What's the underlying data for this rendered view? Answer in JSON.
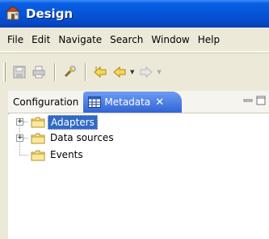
{
  "window": {
    "title": "Design",
    "icon": "design-app-icon"
  },
  "menu": [
    "File",
    "Edit",
    "Navigate",
    "Search",
    "Window",
    "Help"
  ],
  "toolbar": {
    "buttons": [
      "save-icon",
      "print-icon",
      "wrench-icon",
      "back-history-icon",
      "back-arrow-icon",
      "forward-arrow-icon"
    ]
  },
  "tabs": {
    "inactive_label": "Configuration",
    "active_label": "Metadata",
    "close_glyph": "✕",
    "minimize_glyph": "▭",
    "maximize_glyph": "□"
  },
  "tree": {
    "items": [
      {
        "label": "Adapters",
        "expander": "+",
        "selected": true
      },
      {
        "label": "Data sources",
        "expander": "+",
        "selected": false
      },
      {
        "label": "Events",
        "expander": "",
        "selected": false
      }
    ]
  },
  "colors": {
    "titlebar": "#0553d6",
    "selection": "#316ac5",
    "active_tab": "#3165d6",
    "chrome": "#ece9d8"
  }
}
